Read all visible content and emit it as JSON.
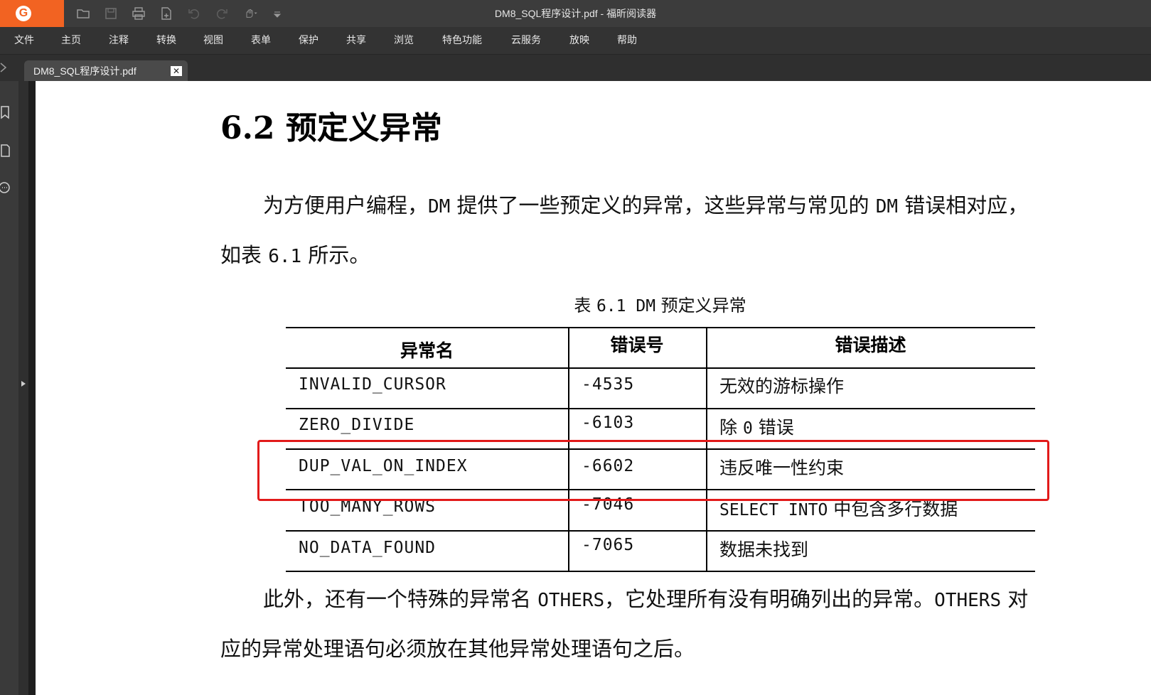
{
  "app": {
    "title": "DM8_SQL程序设计.pdf - 福昕阅读器",
    "logo": "G"
  },
  "quick_access": [
    "open-icon",
    "save-icon",
    "print-icon",
    "new-file-icon",
    "undo-icon",
    "redo-icon",
    "hand-tool-icon",
    "customize-icon"
  ],
  "menu": [
    "文件",
    "主页",
    "注释",
    "转换",
    "视图",
    "表单",
    "保护",
    "共享",
    "浏览",
    "特色功能",
    "云服务",
    "放映",
    "帮助"
  ],
  "tab": {
    "label": "DM8_SQL程序设计.pdf",
    "close": "✕"
  },
  "document": {
    "heading": "6.2 预定义异常",
    "para1_line1": {
      "a": "为方便用户编程，",
      "b": "DM",
      "c": " 提供了一些预定义的异常，这些异常与常见的 ",
      "d": "DM",
      "e": " 错误相对应，"
    },
    "para1_line2": {
      "a": "如表 ",
      "b": "6.1",
      "c": " 所示。"
    },
    "caption": {
      "a": "表 ",
      "b": "6.1  DM",
      "c": " 预定义异常"
    },
    "table": {
      "headers": [
        "异常名",
        "错误号",
        "错误描述"
      ],
      "rows": [
        {
          "name": "INVALID_CURSOR",
          "code": "-4535",
          "desc": "无效的游标操作"
        },
        {
          "name": "ZERO_DIVIDE",
          "code": "-6103",
          "desc_a": "除 ",
          "desc_b": "0",
          "desc_c": " 错误"
        },
        {
          "name": "DUP_VAL_ON_INDEX",
          "code": "-6602",
          "desc": "违反唯一性约束"
        },
        {
          "name": "TOO_MANY_ROWS",
          "code": "-7046",
          "desc_a": "SELECT  INTO",
          "desc_b": " 中包含多行数据"
        },
        {
          "name": "NO_DATA_FOUND",
          "code": "-7065",
          "desc": "数据未找到"
        }
      ]
    },
    "para2_line1": {
      "a": "此外，还有一个特殊的异常名 ",
      "b": "OTHERS",
      "c": "，它处理所有没有明确列出的异常。",
      "d": "OTHERS",
      "e": " 对"
    },
    "para2_line2": "应的异常处理语句必须放在其他异常处理语句之后。"
  },
  "colors": {
    "highlight_box": "#e21a1a",
    "logo_bg": "#f26322"
  }
}
